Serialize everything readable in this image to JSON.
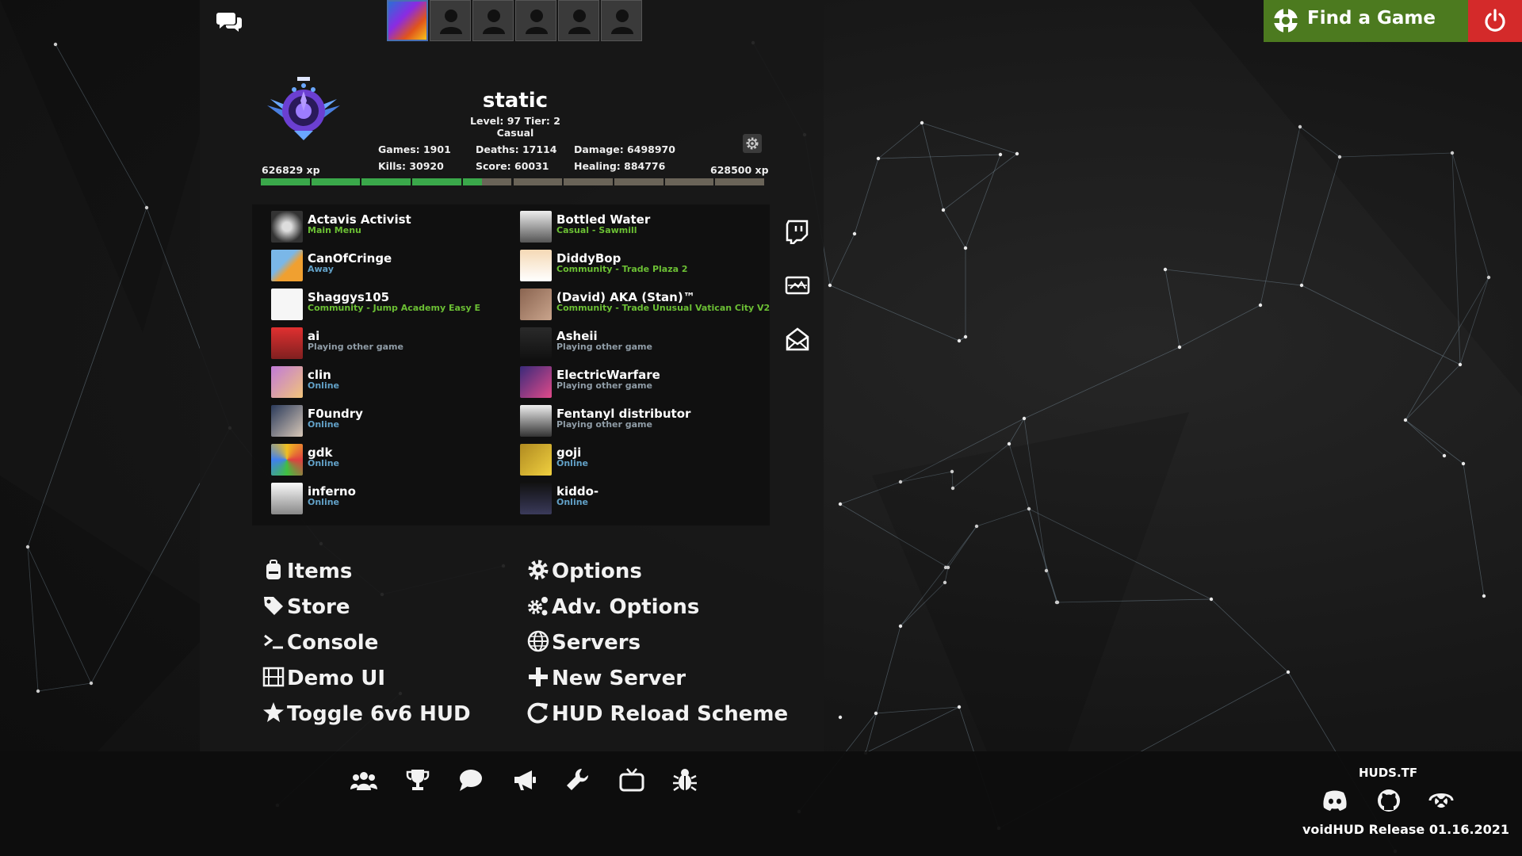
{
  "top": {
    "chat_icon": "chat-bubbles-icon",
    "party_slots": [
      "self-avatar",
      "empty-slot",
      "empty-slot",
      "empty-slot",
      "empty-slot",
      "empty-slot"
    ],
    "find_game_label": "Find a Game",
    "power_icon": "power-icon"
  },
  "profile": {
    "username": "static",
    "level_tier": "Level: 97 Tier: 2",
    "mode": "Casual",
    "games": "Games: 1901",
    "kills": "Kills: 30920",
    "deaths": "Deaths: 17114",
    "score": "Score: 60031",
    "damage": "Damage: 6498970",
    "healing": "Healing: 884776",
    "xp_current": "626829 xp",
    "xp_next": "628500 xp",
    "xp_fill_fraction": 0.44,
    "xp_segments": 10,
    "settings_icon": "gear-icon"
  },
  "friends": [
    {
      "name": "Actavis Activist",
      "status": "Main Menu",
      "status_type": "green"
    },
    {
      "name": "Bottled Water",
      "status": "Casual - Sawmill",
      "status_type": "green"
    },
    {
      "name": "CanOfCringe",
      "status": "Away",
      "status_type": "blue"
    },
    {
      "name": "DiddyBop",
      "status": "Community - Trade Plaza 2",
      "status_type": "green"
    },
    {
      "name": "Shaggys105",
      "status": "Community - Jump Academy Easy E",
      "status_type": "green"
    },
    {
      "name": "(David) AKA (Stan)™",
      "status": "Community - Trade Unusual Vatican City V2",
      "status_type": "green"
    },
    {
      "name": "ai",
      "status": "Playing other game",
      "status_type": "grey"
    },
    {
      "name": "Asheii",
      "status": "Playing other game",
      "status_type": "grey"
    },
    {
      "name": "clin",
      "status": "Online",
      "status_type": "blue"
    },
    {
      "name": "ElectricWarfare",
      "status": "Playing other game",
      "status_type": "grey"
    },
    {
      "name": "F0undry",
      "status": "Online",
      "status_type": "blue"
    },
    {
      "name": "Fentanyl distributor",
      "status": "Playing other game",
      "status_type": "grey"
    },
    {
      "name": "gdk",
      "status": "Online",
      "status_type": "blue"
    },
    {
      "name": "goji",
      "status": "Online",
      "status_type": "blue"
    },
    {
      "name": "inferno",
      "status": "Online",
      "status_type": "blue"
    },
    {
      "name": "kiddo-",
      "status": "Online",
      "status_type": "blue"
    }
  ],
  "side_icons": [
    "twitch-icon",
    "screenshot-icon",
    "mail-icon"
  ],
  "menu": {
    "left": [
      {
        "label": "Items",
        "icon": "backpack-icon"
      },
      {
        "label": "Store",
        "icon": "tag-icon"
      },
      {
        "label": "Console",
        "icon": "terminal-icon"
      },
      {
        "label": "Demo UI",
        "icon": "film-icon"
      },
      {
        "label": "Toggle 6v6 HUD",
        "icon": "star-icon"
      }
    ],
    "right": [
      {
        "label": "Options",
        "icon": "gear-icon"
      },
      {
        "label": "Adv. Options",
        "icon": "gears-icon"
      },
      {
        "label": "Servers",
        "icon": "globe-icon"
      },
      {
        "label": "New Server",
        "icon": "plus-icon"
      },
      {
        "label": "HUD Reload Scheme",
        "icon": "reload-icon"
      }
    ]
  },
  "bottom": {
    "icons": [
      "community-icon",
      "trophy-icon",
      "chat-icon",
      "megaphone-icon",
      "wrench-icon",
      "tv-icon",
      "bug-icon"
    ],
    "huds_label": "HUDS.TF",
    "social_icons": [
      "discord-icon",
      "github-icon",
      "steam-icon"
    ],
    "release_label": "voidHUD Release 01.16.2021"
  }
}
